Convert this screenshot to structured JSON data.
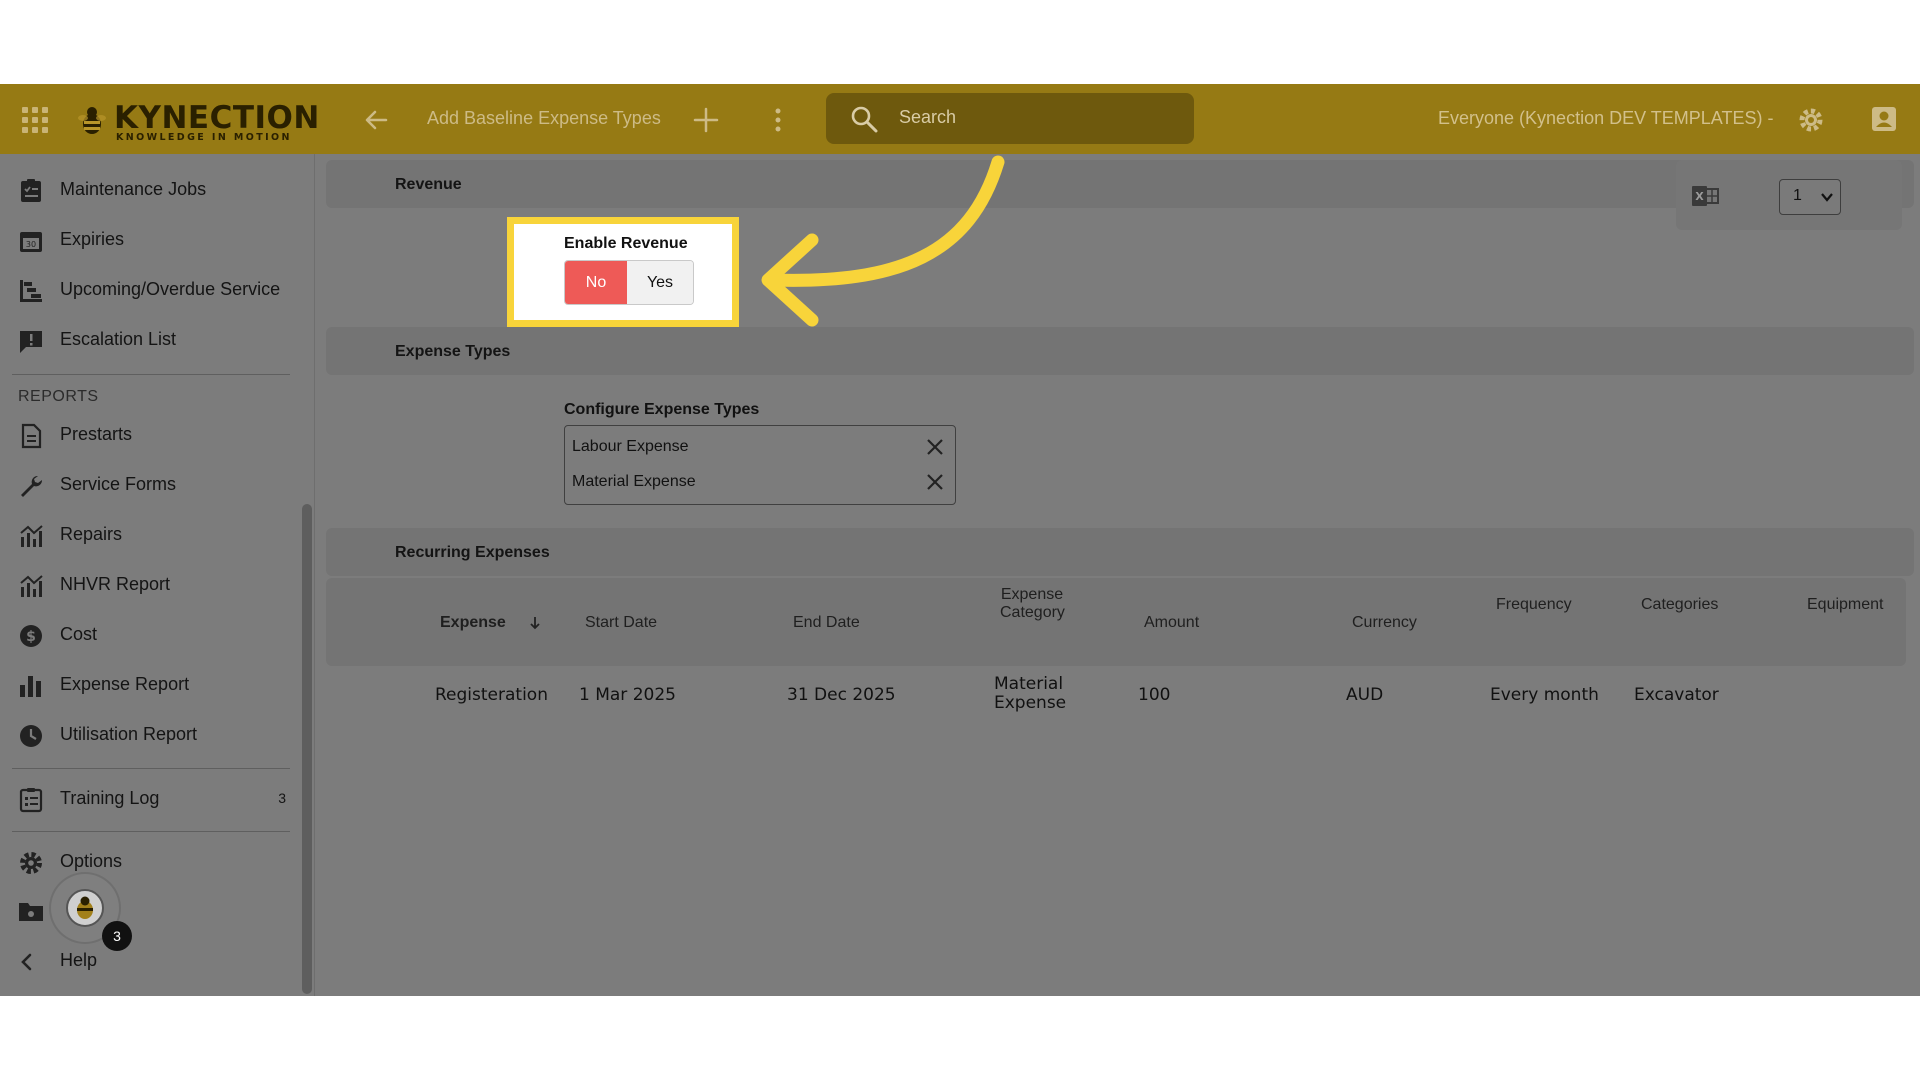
{
  "topbar": {
    "logo_text": "KYNECTION",
    "logo_subtext": "KNOWLEDGE IN MOTION",
    "page_title": "Add Baseline Expense Types",
    "search_placeholder": "Search",
    "scope": "Everyone (Kynection DEV TEMPLATES) -"
  },
  "sidebar": {
    "items_top": [
      {
        "label": "Maintenance Jobs",
        "icon": "clipboard-list-icon"
      },
      {
        "label": "Expiries",
        "icon": "calendar-30-icon"
      },
      {
        "label": "Upcoming/Overdue Service",
        "icon": "gantt-icon"
      },
      {
        "label": "Escalation List",
        "icon": "alert-chat-icon"
      }
    ],
    "reports_heading": "REPORTS",
    "reports": [
      {
        "label": "Prestarts",
        "icon": "document-icon"
      },
      {
        "label": "Service Forms",
        "icon": "wrench-icon"
      },
      {
        "label": "Repairs",
        "icon": "chart-line-icon"
      },
      {
        "label": "NHVR Report",
        "icon": "chart-line-icon"
      },
      {
        "label": "Cost",
        "icon": "dollar-icon"
      },
      {
        "label": "Expense Report",
        "icon": "bar-chart-icon"
      },
      {
        "label": "Utilisation Report",
        "icon": "clock-icon"
      }
    ],
    "training": {
      "label": "Training Log",
      "count": "3",
      "icon": "checklist-icon"
    },
    "options": {
      "label": "Options",
      "icon": "gear-icon"
    },
    "help": {
      "label": "Help",
      "icon": "chevron-left-icon"
    },
    "notification_count": "3"
  },
  "content": {
    "revenue_title": "Revenue",
    "enable_revenue_label": "Enable Revenue",
    "toggle_no": "No",
    "toggle_yes": "Yes",
    "toggle_selected": "No",
    "expense_types_title": "Expense Types",
    "configure_label": "Configure Expense Types",
    "expense_tags": [
      "Labour Expense",
      "Material Expense"
    ],
    "page_select_value": "1",
    "recurring_title": "Recurring Expenses",
    "table": {
      "headers": {
        "expense": "Expense",
        "start_date": "Start Date",
        "end_date": "End Date",
        "expense_category_1": "Expense",
        "expense_category_2": "Category",
        "amount": "Amount",
        "currency": "Currency",
        "frequency": "Frequency",
        "categories": "Categories",
        "equipment": "Equipment"
      },
      "rows": [
        {
          "expense": "Registeration",
          "start_date": "1 Mar 2025",
          "end_date": "31 Dec 2025",
          "category_1": "Material",
          "category_2": "Expense",
          "amount": "100",
          "currency": "AUD",
          "frequency": "Every month",
          "categories": "Excavator",
          "equipment": ""
        }
      ]
    }
  },
  "colors": {
    "topbar": "#967a14",
    "overlay": "#7c7c7c",
    "highlight": "#f8d43a",
    "toggle_no": "#ee5a57"
  }
}
